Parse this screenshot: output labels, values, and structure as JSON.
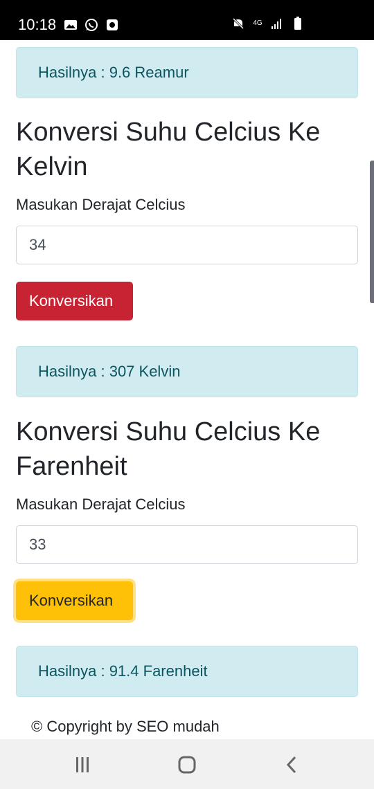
{
  "status_bar": {
    "time": "10:18",
    "left_icons": [
      "image-icon",
      "whatsapp-icon",
      "app-notification-icon"
    ],
    "right_icons": [
      "mute-icon",
      "4g-data-icon",
      "signal-icon",
      "battery-icon"
    ],
    "network_label": "4G"
  },
  "sections": {
    "reamur_result": "Hasilnya : 9.6 Reamur",
    "kelvin": {
      "title": "Konversi Suhu Celcius Ke Kelvin",
      "input_label": "Masukan Derajat Celcius",
      "input_value": "34",
      "button_label": "Konversikan",
      "result": "Hasilnya : 307 Kelvin"
    },
    "farenheit": {
      "title": "Konversi Suhu Celcius Ke Farenheit",
      "input_label": "Masukan Derajat Celcius",
      "input_value": "33",
      "button_label": "Konversikan",
      "result": "Hasilnya : 91.4 Farenheit"
    }
  },
  "footer": {
    "copyright": "© Copyright by SEO mudah"
  },
  "navigation": {
    "buttons": [
      "recent-apps-icon",
      "home-icon",
      "back-icon"
    ]
  },
  "colors": {
    "danger": "#c82333",
    "warning": "#ffc107",
    "alert_bg": "#d1ecf1",
    "alert_text": "#0c5460"
  }
}
